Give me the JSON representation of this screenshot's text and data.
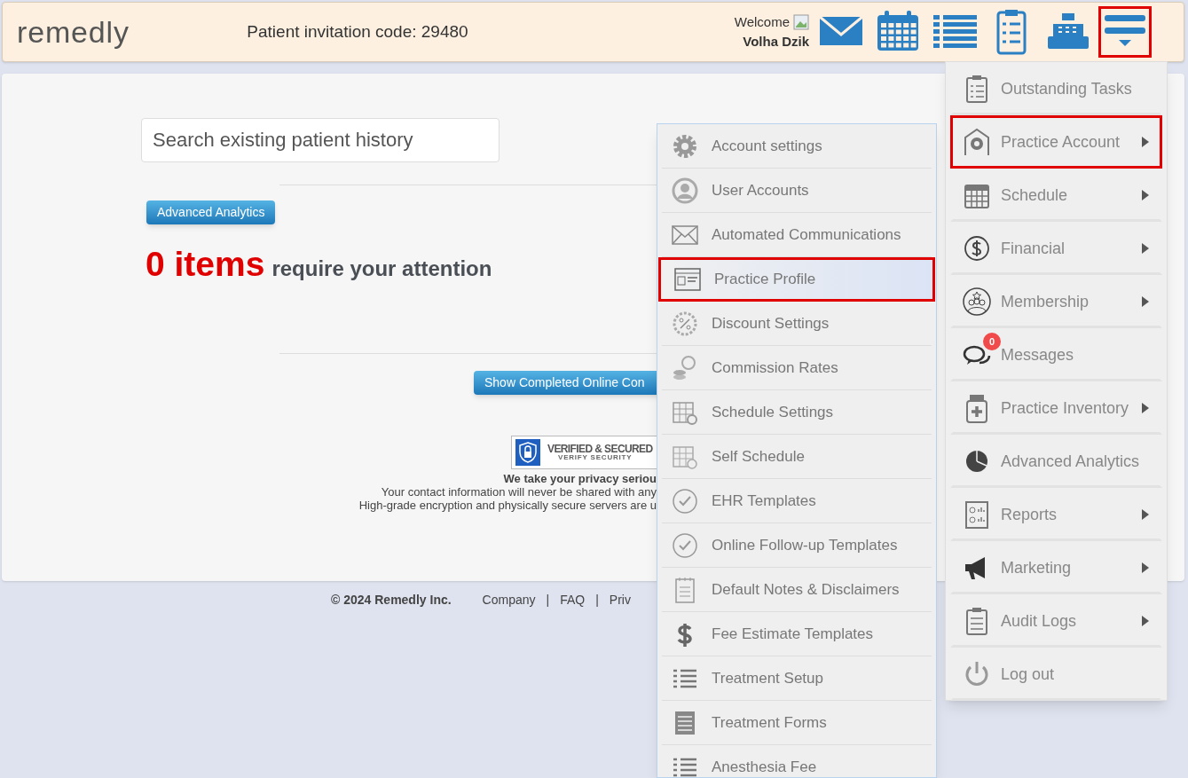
{
  "header": {
    "logo": "remedly",
    "invitation": "Patient invitation code: 29480",
    "welcome": "Welcome",
    "user": "Volha Dzik",
    "tools": [
      {
        "selected": false
      },
      {
        "selected": false
      },
      {
        "selected": false
      },
      {
        "selected": false
      },
      {
        "selected": false
      },
      {
        "selected": true
      }
    ]
  },
  "search": {
    "placeholder": "Search existing patient history"
  },
  "analytics_button": "Advanced Analytics",
  "attention": {
    "count": "0 items",
    "text": "require your attention"
  },
  "completed_button": "Show Completed Online Con",
  "security_badge": {
    "title": "VERIFIED & SECURED",
    "subtitle": "VERIFY SECURITY"
  },
  "privacy": {
    "heading": "We take your privacy seriou",
    "lines": [
      "Your contact information will never be shared with any",
      "High-grade encryption and physically secure servers are u"
    ]
  },
  "footer": {
    "copyright": "© 2024 Remedly Inc.",
    "items": [
      {
        "kind": "link",
        "text": "Company"
      },
      {
        "kind": "separator",
        "text": "|"
      },
      {
        "kind": "link",
        "text": "FAQ"
      },
      {
        "kind": "separator",
        "text": "|"
      },
      {
        "kind": "link",
        "text": "Priv"
      }
    ]
  },
  "main_menu": [
    {
      "label": "Outstanding Tasks",
      "submenu": false,
      "selected": false
    },
    {
      "label": "Practice Account",
      "submenu": true,
      "selected": true
    },
    {
      "label": "Schedule",
      "submenu": true,
      "selected": false
    },
    {
      "label": "Financial",
      "submenu": true,
      "selected": false
    },
    {
      "label": "Membership",
      "submenu": true,
      "selected": false
    },
    {
      "label": "Messages",
      "submenu": false,
      "selected": false,
      "badge": "0"
    },
    {
      "label": "Practice Inventory",
      "submenu": true,
      "selected": false
    },
    {
      "label": "Advanced Analytics",
      "submenu": false,
      "selected": false
    },
    {
      "label": "Reports",
      "submenu": true,
      "selected": false
    },
    {
      "label": "Marketing",
      "submenu": true,
      "selected": false
    },
    {
      "label": "Audit Logs",
      "submenu": true,
      "selected": false
    },
    {
      "label": "Log out",
      "submenu": false,
      "selected": false
    }
  ],
  "sub_menu": [
    {
      "label": "Account settings",
      "selected": false
    },
    {
      "label": "User Accounts",
      "selected": false
    },
    {
      "label": "Automated Communications",
      "selected": false
    },
    {
      "label": "Practice Profile",
      "selected": true
    },
    {
      "label": "Discount Settings",
      "selected": false
    },
    {
      "label": "Commission Rates",
      "selected": false
    },
    {
      "label": "Schedule Settings",
      "selected": false
    },
    {
      "label": "Self Schedule",
      "selected": false
    },
    {
      "label": "EHR Templates",
      "selected": false
    },
    {
      "label": "Online Follow-up Templates",
      "selected": false
    },
    {
      "label": "Default Notes & Disclaimers",
      "selected": false
    },
    {
      "label": "Fee Estimate Templates",
      "selected": false
    },
    {
      "label": "Treatment Setup",
      "selected": false
    },
    {
      "label": "Treatment Forms",
      "selected": false
    },
    {
      "label": "Anesthesia Fee",
      "selected": false
    }
  ]
}
